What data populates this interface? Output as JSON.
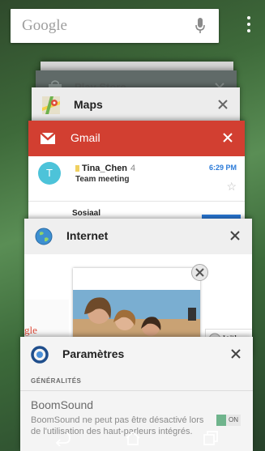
{
  "search": {
    "logo_text": "Google",
    "mic_icon": "mic-icon"
  },
  "menu_icon": "overflow-menu-icon",
  "cards": {
    "partial_top": {
      "title": "Play Store"
    },
    "maps": {
      "title": "Maps",
      "icon": "maps-icon"
    },
    "gmail": {
      "title": "Gmail",
      "accent": "#d23f31",
      "messages": [
        {
          "avatar_letter": "T",
          "sender": "Tina_Chen",
          "count": "4",
          "subject": "Team meeting",
          "time": "6:29 PM"
        },
        {
          "sender": "Sosiaal"
        }
      ]
    },
    "internet": {
      "title": "Internet",
      "icon": "globe-icon",
      "google_fragment": "gle",
      "wiki_fragment": "Wik"
    },
    "settings": {
      "title": "Paramètres",
      "section_label": "GÉNÉRALITÉS",
      "item_title": "BoomSound",
      "item_description": "BoomSound ne peut pas être désactivé lors de l'utilisation des haut-parleurs intégrés.",
      "toggle_label": "ON"
    }
  },
  "navbar": {
    "back_icon": "back-icon",
    "home_icon": "home-icon",
    "recents_icon": "recents-icon"
  }
}
